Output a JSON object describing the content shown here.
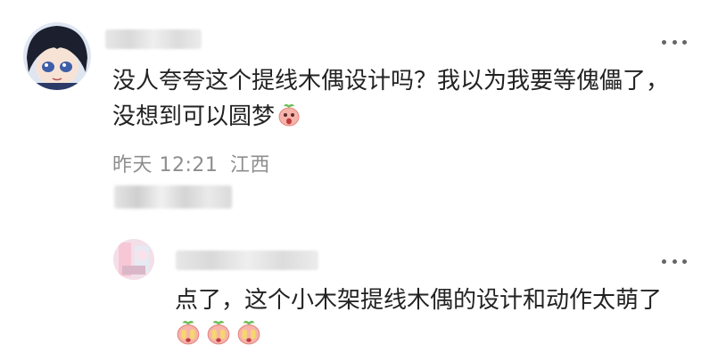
{
  "main_comment": {
    "text_line1": "没人夸夸这个提线木偶设计吗？我以为我要等傀儡了，",
    "text_line2": "没想到可以圆梦",
    "emoji": "peach-surprised-emoji",
    "timestamp": "昨天 12:21",
    "location": "江西"
  },
  "reply": {
    "text": "点了，这个小木架提线木偶的设计和动作太萌了",
    "emojis": [
      "peach-crying-emoji",
      "peach-crying-emoji",
      "peach-crying-emoji"
    ]
  },
  "colors": {
    "text": "#222222",
    "meta": "#8e8e8e",
    "peach": "#f4a7a0"
  }
}
